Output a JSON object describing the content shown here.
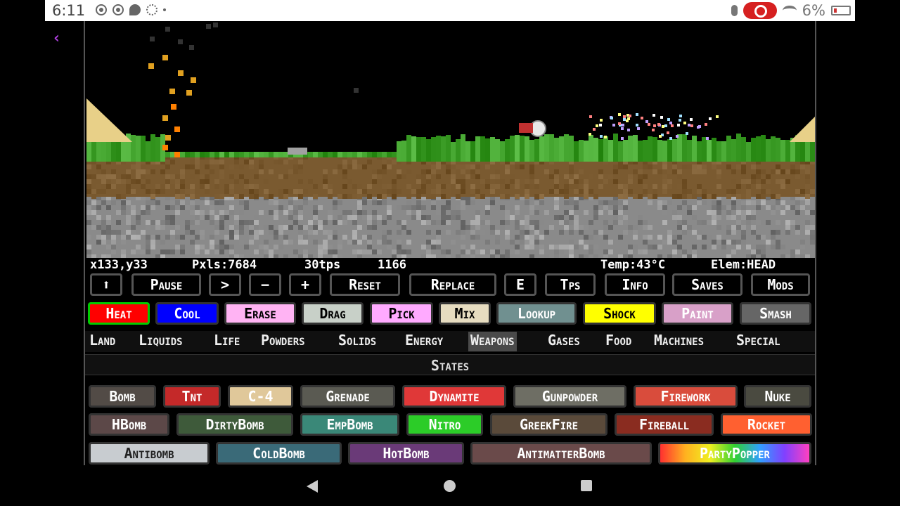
{
  "status_bar": {
    "time": "6:11",
    "battery": "6%",
    "icons": [
      "record-icon",
      "record-icon",
      "chat-icon",
      "gear-icon",
      "dot-icon",
      "mic-icon",
      "screen-record-icon",
      "wifi-icon",
      "battery-icon"
    ]
  },
  "back_glyph": "‹",
  "info": {
    "coords": "x133,y33",
    "pixels": "Pxls:7684",
    "tps": "30tps",
    "counter": "1166",
    "temp": "Temp:43°C",
    "elem": "Elem:HEAD"
  },
  "controls": [
    {
      "label": "⬆",
      "name": "up-button"
    },
    {
      "label": "Pause",
      "name": "pause-button"
    },
    {
      "label": ">",
      "name": "step-button"
    },
    {
      "label": "−",
      "name": "minus-button"
    },
    {
      "label": "+",
      "name": "plus-button"
    },
    {
      "label": "Reset",
      "name": "reset-button"
    },
    {
      "label": "Replace",
      "name": "replace-button"
    },
    {
      "label": "E",
      "name": "e-button"
    },
    {
      "label": "Tps",
      "name": "tps-button"
    },
    {
      "label": "Info",
      "name": "info-button"
    },
    {
      "label": "Saves",
      "name": "saves-button"
    },
    {
      "label": "Mods",
      "name": "mods-button"
    }
  ],
  "tools": [
    {
      "label": "Heat",
      "bg": "#ff0000",
      "fg": "#ffffff",
      "border": "#00cc00"
    },
    {
      "label": "Cool",
      "bg": "#0000ff",
      "fg": "#ffffff",
      "border": "#333333"
    },
    {
      "label": "Erase",
      "bg": "#ffb3f3",
      "fg": "#000000",
      "border": "#333333"
    },
    {
      "label": "Drag",
      "bg": "#c8d0c8",
      "fg": "#000000",
      "border": "#333333"
    },
    {
      "label": "Pick",
      "bg": "#ffaaff",
      "fg": "#000000",
      "border": "#333333"
    },
    {
      "label": "Mix",
      "bg": "#e6dcc0",
      "fg": "#000000",
      "border": "#333333"
    },
    {
      "label": "Lookup",
      "bg": "#709090",
      "fg": "#ffffff",
      "border": "#333333"
    },
    {
      "label": "Shock",
      "bg": "#ffff00",
      "fg": "#000000",
      "border": "#333333"
    },
    {
      "label": "Paint",
      "bg": "#d8a0c8",
      "fg": "#ffffff",
      "border": "#333333"
    },
    {
      "label": "Smash",
      "bg": "#666666",
      "fg": "#ffffff",
      "border": "#333333"
    }
  ],
  "categories": [
    {
      "label": "Land",
      "active": false
    },
    {
      "label": "Liquids",
      "active": false
    },
    {
      "label": "Life",
      "active": false
    },
    {
      "label": "Powders",
      "active": false
    },
    {
      "label": "Solids",
      "active": false
    },
    {
      "label": "Energy",
      "active": false
    },
    {
      "label": "Weapons",
      "active": true
    },
    {
      "label": "Gases",
      "active": false
    },
    {
      "label": "Food",
      "active": false
    },
    {
      "label": "Machines",
      "active": false
    },
    {
      "label": "Special",
      "active": false
    }
  ],
  "states_label": "States",
  "elements": [
    [
      {
        "label": "Bomb",
        "bg": "#524b46",
        "fg": "#ffffff"
      },
      {
        "label": "Tnt",
        "bg": "#c42929",
        "fg": "#ffffff"
      },
      {
        "label": "C-4",
        "bg": "#e0c89a",
        "fg": "#ffffff"
      },
      {
        "label": "Grenade",
        "bg": "#5a5a52",
        "fg": "#ffffff"
      },
      {
        "label": "Dynamite",
        "bg": "#e03838",
        "fg": "#ffffff"
      },
      {
        "label": "Gunpowder",
        "bg": "#6e6e64",
        "fg": "#ffffff"
      },
      {
        "label": "Firework",
        "bg": "#d94c3c",
        "fg": "#ffffff"
      },
      {
        "label": "Nuke",
        "bg": "#4a4a40",
        "fg": "#ffffff"
      }
    ],
    [
      {
        "label": "HBomb",
        "bg": "#5c4848",
        "fg": "#ffffff"
      },
      {
        "label": "DirtyBomb",
        "bg": "#3e5a3a",
        "fg": "#ffffff"
      },
      {
        "label": "EmpBomb",
        "bg": "#3a8878",
        "fg": "#ffffff"
      },
      {
        "label": "Nitro",
        "bg": "#2ccc28",
        "fg": "#ffffff"
      },
      {
        "label": "GreekFire",
        "bg": "#5a4a3a",
        "fg": "#ffffff"
      },
      {
        "label": "Fireball",
        "bg": "#8a2c20",
        "fg": "#ffffff"
      },
      {
        "label": "Rocket",
        "bg": "#ff6030",
        "fg": "#ffffff"
      }
    ],
    [
      {
        "label": "Antibomb",
        "bg": "#c8ccd0",
        "fg": "#222222"
      },
      {
        "label": "ColdBomb",
        "bg": "#3a6a78",
        "fg": "#ffffff"
      },
      {
        "label": "HotBomb",
        "bg": "#6a3a78",
        "fg": "#ffffff"
      },
      {
        "label": "AntimatterBomb",
        "bg": "#6a4a4a",
        "fg": "#ffffff"
      },
      {
        "label": "PartyPopper",
        "bg": "rainbow",
        "fg": "#ffffff"
      }
    ]
  ],
  "colors": {
    "grass": "#3fa02a",
    "dirt": "#7a5a30",
    "rock": "#8a8a8a",
    "sand": "#e8d088",
    "fire": "#ff8000"
  }
}
